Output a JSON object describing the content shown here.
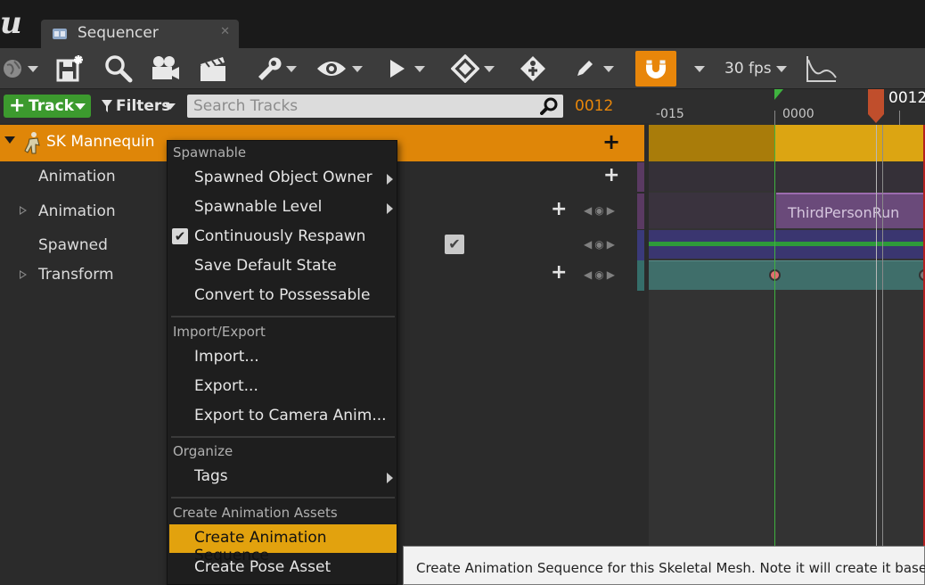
{
  "window": {
    "tab_title": "Sequencer",
    "tab_close": "✕"
  },
  "toolbar": {
    "buttons": [
      {
        "icon": "world-icon",
        "has_menu": true
      },
      {
        "icon": "save-as-icon",
        "has_menu": false
      },
      {
        "icon": "search-icon",
        "has_menu": false
      },
      {
        "icon": "camera-icon",
        "has_menu": false
      },
      {
        "icon": "clapperboard-icon",
        "has_menu": false
      },
      {
        "icon": "wrench-icon",
        "has_menu": true
      },
      {
        "icon": "eye-icon",
        "has_menu": true
      },
      {
        "icon": "play-icon",
        "has_menu": true
      },
      {
        "icon": "key-icon",
        "has_menu": true
      },
      {
        "icon": "tag-key-icon",
        "has_menu": false
      },
      {
        "icon": "pencil-icon",
        "has_menu": true
      },
      {
        "icon": "magnet-snap-icon",
        "has_menu": true
      },
      {
        "icon": "curve-editor-icon",
        "has_menu": false
      }
    ],
    "fps_label": "30 fps",
    "accent_color": "#e8860a"
  },
  "filter_bar": {
    "track_label": "Track",
    "filters_label": "Filters",
    "search_placeholder": "Search Tracks",
    "current_frame": "0012"
  },
  "timeline": {
    "ruler_labels": [
      "-015",
      "0000"
    ],
    "playhead_label": "0012",
    "section_label": "ThirdPersonRun"
  },
  "outliner": {
    "actor": {
      "label": "SK Mannequin",
      "add": "+",
      "color": "#df8608"
    },
    "tracks": [
      {
        "label": "Animation",
        "expandable": false,
        "add": "+",
        "strip_color": "#6a3f7a"
      },
      {
        "label": "Animation",
        "expandable": true,
        "add": "+",
        "strip_color": "#6a3f7a"
      },
      {
        "label": "Spawned",
        "expandable": false,
        "checked": "✔",
        "strip_color": "#3f3f8a"
      },
      {
        "label": "Transform",
        "expandable": true,
        "add": "+",
        "strip_color": "#3d7a78"
      }
    ],
    "key_nav": {
      "prev": "◀",
      "add": "◉",
      "next": "▶"
    }
  },
  "context_menu": {
    "sections": [
      {
        "heading": "Spawnable",
        "items": [
          {
            "label": "Spawned Object Owner",
            "submenu": true
          },
          {
            "label": "Spawnable Level",
            "submenu": true
          },
          {
            "label": "Continuously Respawn",
            "checked": true
          },
          {
            "label": "Save Default State"
          },
          {
            "label": "Convert to Possessable"
          }
        ]
      },
      {
        "heading": "Import/Export",
        "items": [
          {
            "label": "Import..."
          },
          {
            "label": "Export..."
          },
          {
            "label": "Export to Camera Anim..."
          }
        ]
      },
      {
        "heading": "Organize",
        "items": [
          {
            "label": "Tags",
            "submenu": true
          }
        ]
      },
      {
        "heading": "Create Animation Assets",
        "items": [
          {
            "label": "Create Animation Sequence",
            "highlighted": true
          },
          {
            "label": "Create Pose Asset"
          }
        ]
      }
    ],
    "highlight_color": "#e2a20e"
  },
  "tooltip": {
    "text": "Create Animation Sequence for this Skeletal Mesh. Note it will create it based upo"
  }
}
